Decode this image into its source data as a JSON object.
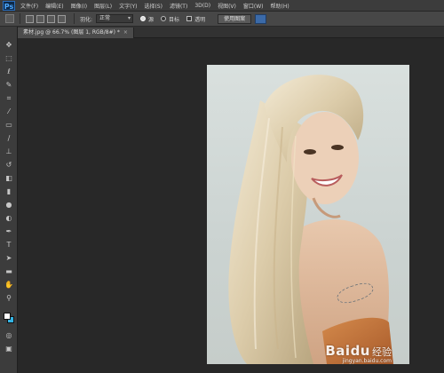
{
  "app": {
    "logo": "Ps"
  },
  "menu": [
    "文件(F)",
    "编辑(E)",
    "图像(I)",
    "图层(L)",
    "文字(Y)",
    "选择(S)",
    "滤镜(T)",
    "3D(D)",
    "视图(V)",
    "窗口(W)",
    "帮助(H)"
  ],
  "options": {
    "feather_label": "羽化:",
    "mode_value": "正常",
    "source_label": "源",
    "target_label": "目标",
    "transparent_label": "透明",
    "use_pattern_label": "使用图案"
  },
  "document_tab": {
    "title": "素材.jpg @ 66.7% (图层 1, RGB/8#) *",
    "close": "×"
  },
  "tools": [
    "move-tool-icon",
    "marquee-tool-icon",
    "lasso-tool-icon",
    "quick-select-tool-icon",
    "crop-tool-icon",
    "eyedropper-tool-icon",
    "healing-tool-icon",
    "brush-tool-icon",
    "stamp-tool-icon",
    "history-brush-icon",
    "eraser-tool-icon",
    "gradient-tool-icon",
    "blur-tool-icon",
    "dodge-tool-icon",
    "pen-tool-icon",
    "type-tool-icon",
    "path-select-tool-icon",
    "shape-tool-icon",
    "hand-tool-icon",
    "zoom-tool-icon"
  ],
  "colors": {
    "foreground": "#ffffff",
    "background": "#34b4e4",
    "options_blue": "#3b6aa8"
  },
  "watermark": {
    "logo": "Baidu",
    "text": "经验",
    "sub": "jingyan.baidu.com"
  }
}
